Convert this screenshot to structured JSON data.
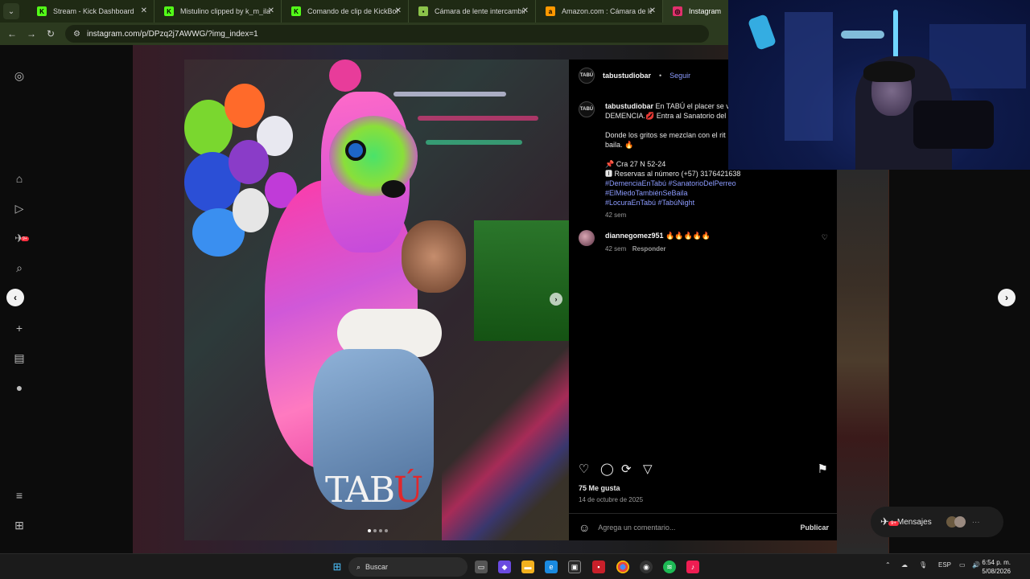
{
  "browser": {
    "tabs": [
      {
        "label": "Stream - Kick Dashboard",
        "favicon": "kick-icon",
        "color": "#53fc18",
        "active": false
      },
      {
        "label": "Mistulino clipped by k_m_ila",
        "favicon": "kick-icon",
        "color": "#53fc18",
        "active": false
      },
      {
        "label": "Comando de clip de KickBot",
        "favicon": "kick-icon",
        "color": "#53fc18",
        "active": false
      },
      {
        "label": "Cámara de lente intercambiable",
        "favicon": "document-icon",
        "color": "#8bc34a",
        "active": false
      },
      {
        "label": "Amazon.com : Cámara de lente",
        "favicon": "amazon-icon",
        "color": "#ff9900",
        "active": false
      },
      {
        "label": "Instagram",
        "favicon": "instagram-icon",
        "color": "#e1306c",
        "active": true
      }
    ],
    "url": "instagram.com/p/DPzq2j7AWWG/?img_index=1"
  },
  "post": {
    "username": "tabustudiobar",
    "follow_label": "Seguir",
    "avatar_text": "TABÚ",
    "caption_lines": [
      "En TABÚ el placer se v",
      "DEMENCIA.💋 Entra al Sanatorio del",
      "",
      "Donde los gritos se mezclan con el rit",
      "baila. 🔥",
      "",
      "📌 Cra 27 N 52-24",
      "🅸 Reservas al número (+57) 3176421638"
    ],
    "hashtags": [
      "#DemenciaEnTabú #SanatorioDelPerreo",
      "#ElMiedoTambiénSeBaila",
      "#LocuraEnTabú #TabúNight"
    ],
    "caption_time": "42 sem",
    "comment": {
      "user": "diannegomez951",
      "text": "🔥🔥🔥🔥🔥",
      "time": "42 sem",
      "reply_label": "Responder"
    },
    "likes": "75 Me gusta",
    "date": "14 de octubre de 2025",
    "comment_placeholder": "Agrega un comentario...",
    "publish_label": "Publicar",
    "image_logo": {
      "left": "TAB",
      "right": "Ú"
    },
    "carousel": {
      "total": 4,
      "current": 1
    }
  },
  "messages": {
    "label": "Mensajes",
    "badge": "9+"
  },
  "sidebar_badge": "9+",
  "taskbar": {
    "search_label": "Buscar",
    "lang": "ESP",
    "time": "6:54 p. m.",
    "date": "5/08/2026"
  }
}
